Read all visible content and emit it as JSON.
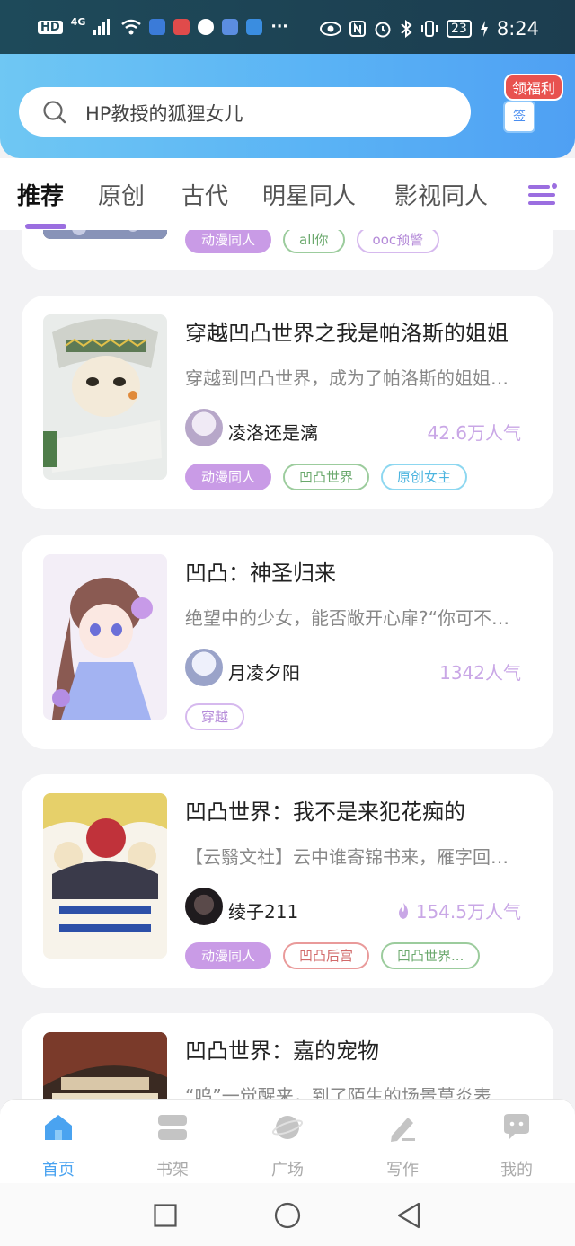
{
  "status_bar": {
    "network_badge": "HD",
    "signal": "4G",
    "battery": "23",
    "time": "8:24"
  },
  "search": {
    "text": "HP教授的狐狸女儿",
    "icon": "search-icon"
  },
  "welfare": {
    "label": "领福利",
    "sign_label": "签"
  },
  "tabs": [
    {
      "label": "推荐",
      "active": true
    },
    {
      "label": "原创"
    },
    {
      "label": "古代"
    },
    {
      "label": "明星同人"
    },
    {
      "label": "影视同人"
    }
  ],
  "cards": [
    {
      "title": "",
      "tags": [
        {
          "label": "动漫同人",
          "style": "purple"
        },
        {
          "label": "all你",
          "style": "green"
        },
        {
          "label": "ooc预警",
          "style": "lav"
        }
      ]
    },
    {
      "title": "穿越凹凸世界之我是帕洛斯的姐姐",
      "desc": "穿越到凹凸世界，成为了帕洛斯的姐姐…",
      "author": "凌洛还是漓",
      "popularity": "42.6万人气",
      "hot": false,
      "tags": [
        {
          "label": "动漫同人",
          "style": "purple"
        },
        {
          "label": "凹凸世界",
          "style": "green"
        },
        {
          "label": "原创女主",
          "style": "blue"
        }
      ]
    },
    {
      "title": "凹凸：神圣归来",
      "desc": "绝望中的少女，能否敞开心扉?“你可不…",
      "author": "月凌夕阳",
      "popularity": "1342人气",
      "hot": false,
      "tags": [
        {
          "label": "穿越",
          "style": "lav"
        }
      ]
    },
    {
      "title": "凹凸世界：我不是来犯花痴的",
      "desc": "【云翳文社】云中谁寄锦书来，雁字回…",
      "author": "绫子211",
      "popularity": "154.5万人气",
      "hot": true,
      "tags": [
        {
          "label": "动漫同人",
          "style": "purple"
        },
        {
          "label": "凹凸后宫",
          "style": "red"
        },
        {
          "label": "凹凸世界...",
          "style": "green"
        }
      ]
    },
    {
      "title": "凹凸世界：嘉的宠物",
      "desc": "“呜”一觉醒来，到了陌生的场景莫炎表"
    }
  ],
  "bottom_nav": [
    {
      "label": "首页",
      "icon": "home-icon",
      "active": true
    },
    {
      "label": "书架",
      "icon": "bookshelf-icon"
    },
    {
      "label": "广场",
      "icon": "planet-icon"
    },
    {
      "label": "写作",
      "icon": "pen-icon"
    },
    {
      "label": "我的",
      "icon": "chat-bubble-icon"
    }
  ],
  "colors": {
    "accent_purple": "#9b6ee0",
    "header_blue": "#5ab3f5",
    "nav_active": "#4aa3f0",
    "popularity": "#c9a7e6"
  }
}
